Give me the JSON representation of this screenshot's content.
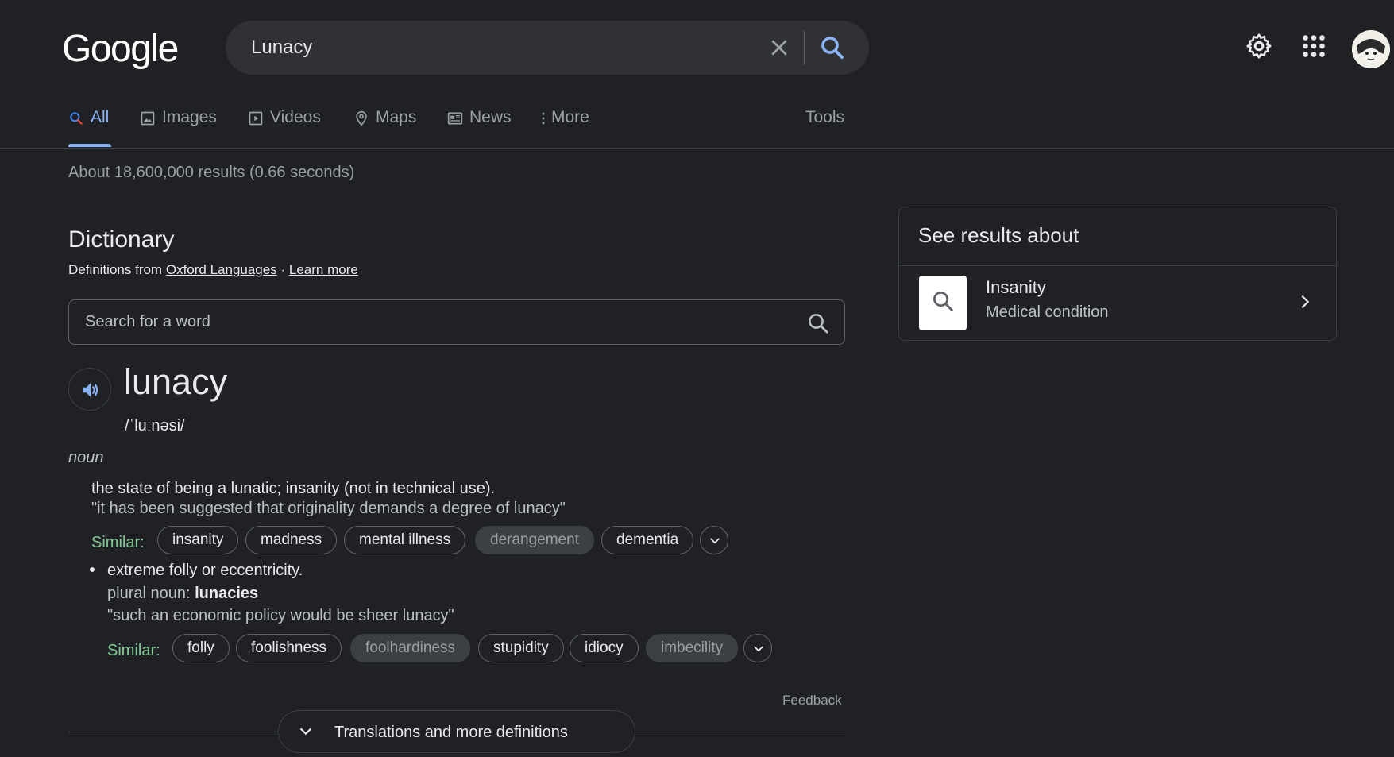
{
  "header": {
    "logo_text": "Google",
    "query": "Lunacy"
  },
  "tabs": [
    {
      "label": "All",
      "icon": "search-icon"
    },
    {
      "label": "Images",
      "icon": "image-icon"
    },
    {
      "label": "Videos",
      "icon": "video-icon"
    },
    {
      "label": "Maps",
      "icon": "map-pin-icon"
    },
    {
      "label": "News",
      "icon": "news-icon"
    },
    {
      "label": "More",
      "icon": "more-vert-icon"
    }
  ],
  "tools_label": "Tools",
  "result_stats": "About 18,600,000 results (0.66 seconds)",
  "dictionary": {
    "title": "Dictionary",
    "source_prefix": "Definitions from",
    "source_link": "Oxford Languages",
    "separator": "·",
    "learn_more": "Learn more",
    "search_placeholder": "Search for a word",
    "headword": "lunacy",
    "phonetic": "/ˈluːnəsi/",
    "part_of_speech": "noun",
    "senses": [
      {
        "definition": "the state of being a lunatic; insanity (not in technical use).",
        "example": "\"it has been suggested that originality demands a degree of lunacy\"",
        "similar_label": "Similar:",
        "similar": [
          "insanity",
          "madness",
          "mental illness",
          "derangement",
          "dementia"
        ]
      },
      {
        "definition": "extreme folly or eccentricity.",
        "plural_label": "plural noun:",
        "plural_value": "lunacies",
        "example": "\"such an economic policy would be sheer lunacy\"",
        "similar_label": "Similar:",
        "similar": [
          "folly",
          "foolishness",
          "foolhardiness",
          "stupidity",
          "idiocy",
          "imbecility"
        ]
      }
    ],
    "feedback": "Feedback",
    "more_definitions": "Translations and more definitions"
  },
  "side_panel": {
    "title": "See results about",
    "item_name": "Insanity",
    "item_subtitle": "Medical condition"
  },
  "colors": {
    "background": "#202124",
    "accent_blue": "#8ab4f8",
    "similar_green": "#81c995"
  }
}
